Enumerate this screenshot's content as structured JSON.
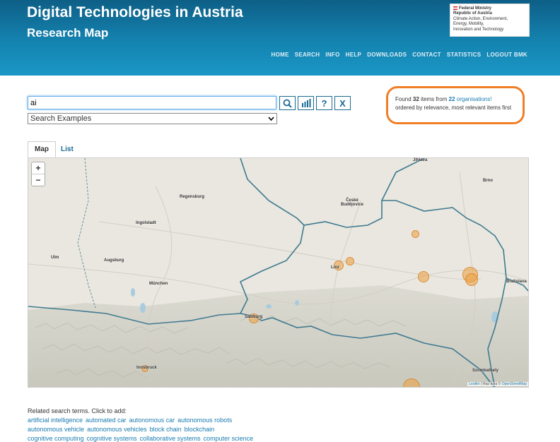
{
  "header": {
    "title": "Digital Technologies in Austria",
    "subtitle": "Research Map",
    "ministry": [
      "Federal Ministry",
      "Republic of Austria",
      "Climate Action, Environment,",
      "Energy, Mobility,",
      "Innovation and Technology"
    ],
    "nav": [
      "HOME",
      "SEARCH",
      "INFO",
      "HELP",
      "DOWNLOADS",
      "CONTACT",
      "STATISTICS",
      "LOGOUT BMK"
    ]
  },
  "search": {
    "value": "ai",
    "examples_label": "Search Examples",
    "buttons": [
      "search-icon",
      "bar-chart-icon",
      "help-icon",
      "clear-icon"
    ]
  },
  "results": {
    "found_prefix": "Found",
    "count": "32",
    "items_from": "items from",
    "org_count": "22",
    "org_label": "organisations!",
    "ordered": "ordered by relevance, most relevant items first"
  },
  "tabs": [
    "Map",
    "List"
  ],
  "map": {
    "zoom_in": "+",
    "zoom_out": "−",
    "cities": [
      "Jihlava",
      "Regensburg",
      "České Budějovice",
      "Brno",
      "Ingolstadt",
      "Ulm",
      "Augsburg",
      "Linz",
      "München",
      "Bratislava",
      "Salzburg",
      "Innsbruck",
      "Szombathely"
    ],
    "attribution_leaflet": "Leaflet",
    "attribution_text": "| Map data ©",
    "attribution_osm": "OpenStreetMap"
  },
  "related": {
    "title": "Related search terms. Click to add:",
    "lines": [
      [
        "artificial intelligence",
        "automated car",
        "autonomous car",
        "autonomous robots"
      ],
      [
        "autonomous vehicle",
        "autonomous vehicles",
        "block chain",
        "blockchain"
      ],
      [
        "cognitive computing",
        "cognitive systems",
        "collaborative systems",
        "computer science"
      ]
    ]
  },
  "colors": {
    "header": "#1483b0",
    "accent": "#1a7bb0",
    "highlight": "#f07e26",
    "marker": "#eca03e"
  }
}
